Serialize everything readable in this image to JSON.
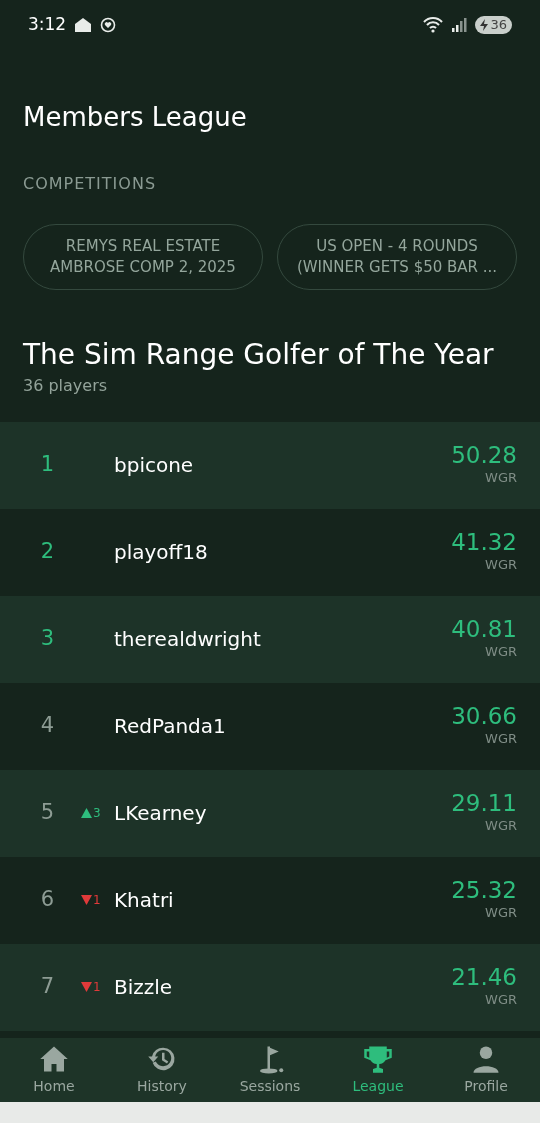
{
  "status_bar": {
    "time": "3:12",
    "battery": "36"
  },
  "header": {
    "title": "Members League"
  },
  "competitions": {
    "label": "COMPETITIONS",
    "items": [
      {
        "lines": [
          "REMYS REAL ESTATE",
          "AMBROSE COMP 2, 2025"
        ]
      },
      {
        "lines": [
          "US OPEN - 4 ROUNDS",
          "(WINNER GETS $50 BAR ..."
        ]
      }
    ]
  },
  "league": {
    "title": "The Sim Range Golfer of The Year",
    "subtitle": "36 players"
  },
  "rows": [
    {
      "rank": "1",
      "highlighted": true,
      "name": "bpicone",
      "score": "50.28",
      "unit": "WGR"
    },
    {
      "rank": "2",
      "highlighted": true,
      "name": "playoff18",
      "score": "41.32",
      "unit": "WGR"
    },
    {
      "rank": "3",
      "highlighted": true,
      "name": "therealdwright",
      "score": "40.81",
      "unit": "WGR"
    },
    {
      "rank": "4",
      "highlighted": false,
      "name": "RedPanda1",
      "score": "30.66",
      "unit": "WGR"
    },
    {
      "rank": "5",
      "highlighted": false,
      "movement": {
        "kind": "up",
        "amount": "3"
      },
      "name": "LKearney",
      "score": "29.11",
      "unit": "WGR"
    },
    {
      "rank": "6",
      "highlighted": false,
      "movement": {
        "kind": "down",
        "amount": "1"
      },
      "name": "Khatri",
      "score": "25.32",
      "unit": "WGR"
    },
    {
      "rank": "7",
      "highlighted": false,
      "movement": {
        "kind": "down",
        "amount": "1"
      },
      "name": "Bizzle",
      "score": "21.46",
      "unit": "WGR"
    }
  ],
  "nav": [
    {
      "kind": "home",
      "label": "Home",
      "selected": false
    },
    {
      "kind": "history",
      "label": "History",
      "selected": false
    },
    {
      "kind": "sessions",
      "label": "Sessions",
      "selected": false
    },
    {
      "kind": "league",
      "label": "League",
      "selected": true
    },
    {
      "kind": "profile",
      "label": "Profile",
      "selected": false
    }
  ]
}
